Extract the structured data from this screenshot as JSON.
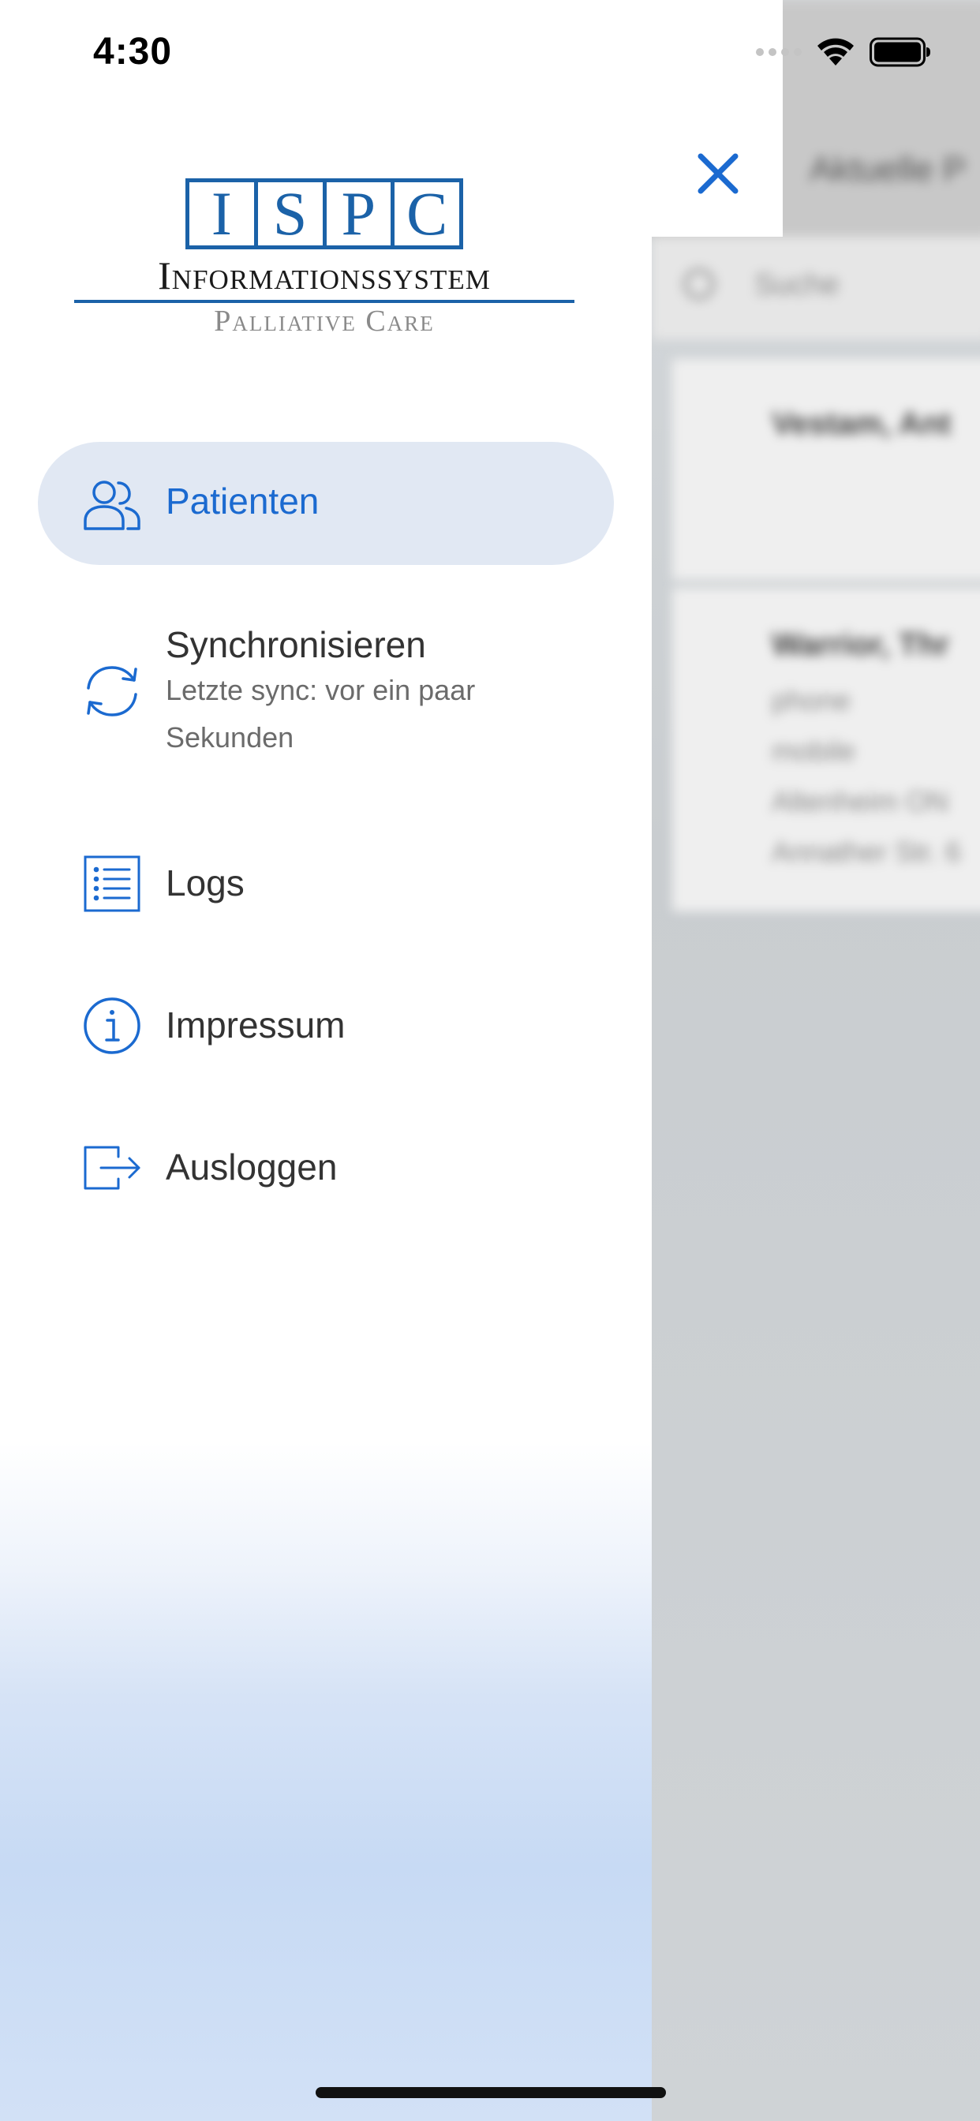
{
  "status_bar": {
    "time": "4:30"
  },
  "logo": {
    "letters": [
      "I",
      "S",
      "P",
      "C"
    ],
    "main": "Informationssystem",
    "sub": "Palliative Care"
  },
  "menu": {
    "items": [
      {
        "label": "Patienten",
        "icon": "patients-icon",
        "active": true
      },
      {
        "label": "Synchronisieren",
        "sub": "Letzte sync: vor ein paar Sekunden",
        "icon": "sync-icon",
        "active": false
      },
      {
        "label": "Logs",
        "icon": "list-icon",
        "active": false
      },
      {
        "label": "Impressum",
        "icon": "info-icon",
        "active": false
      },
      {
        "label": "Ausloggen",
        "icon": "logout-icon",
        "active": false
      }
    ]
  },
  "background": {
    "title": "Aktuelle P",
    "search_placeholder": "Suche",
    "cards": [
      {
        "name": "Vestam, Ant"
      },
      {
        "name": "Warrior, Thr",
        "lines": [
          "phone",
          "mobile",
          "Altenheim ON",
          "Annather Str. 6"
        ]
      }
    ]
  },
  "colors": {
    "accent": "#1b6ad0",
    "logo_blue": "#1b62a8",
    "active_bg": "#e1e8f3",
    "text": "#333333",
    "subtext": "#6b6b6b"
  }
}
